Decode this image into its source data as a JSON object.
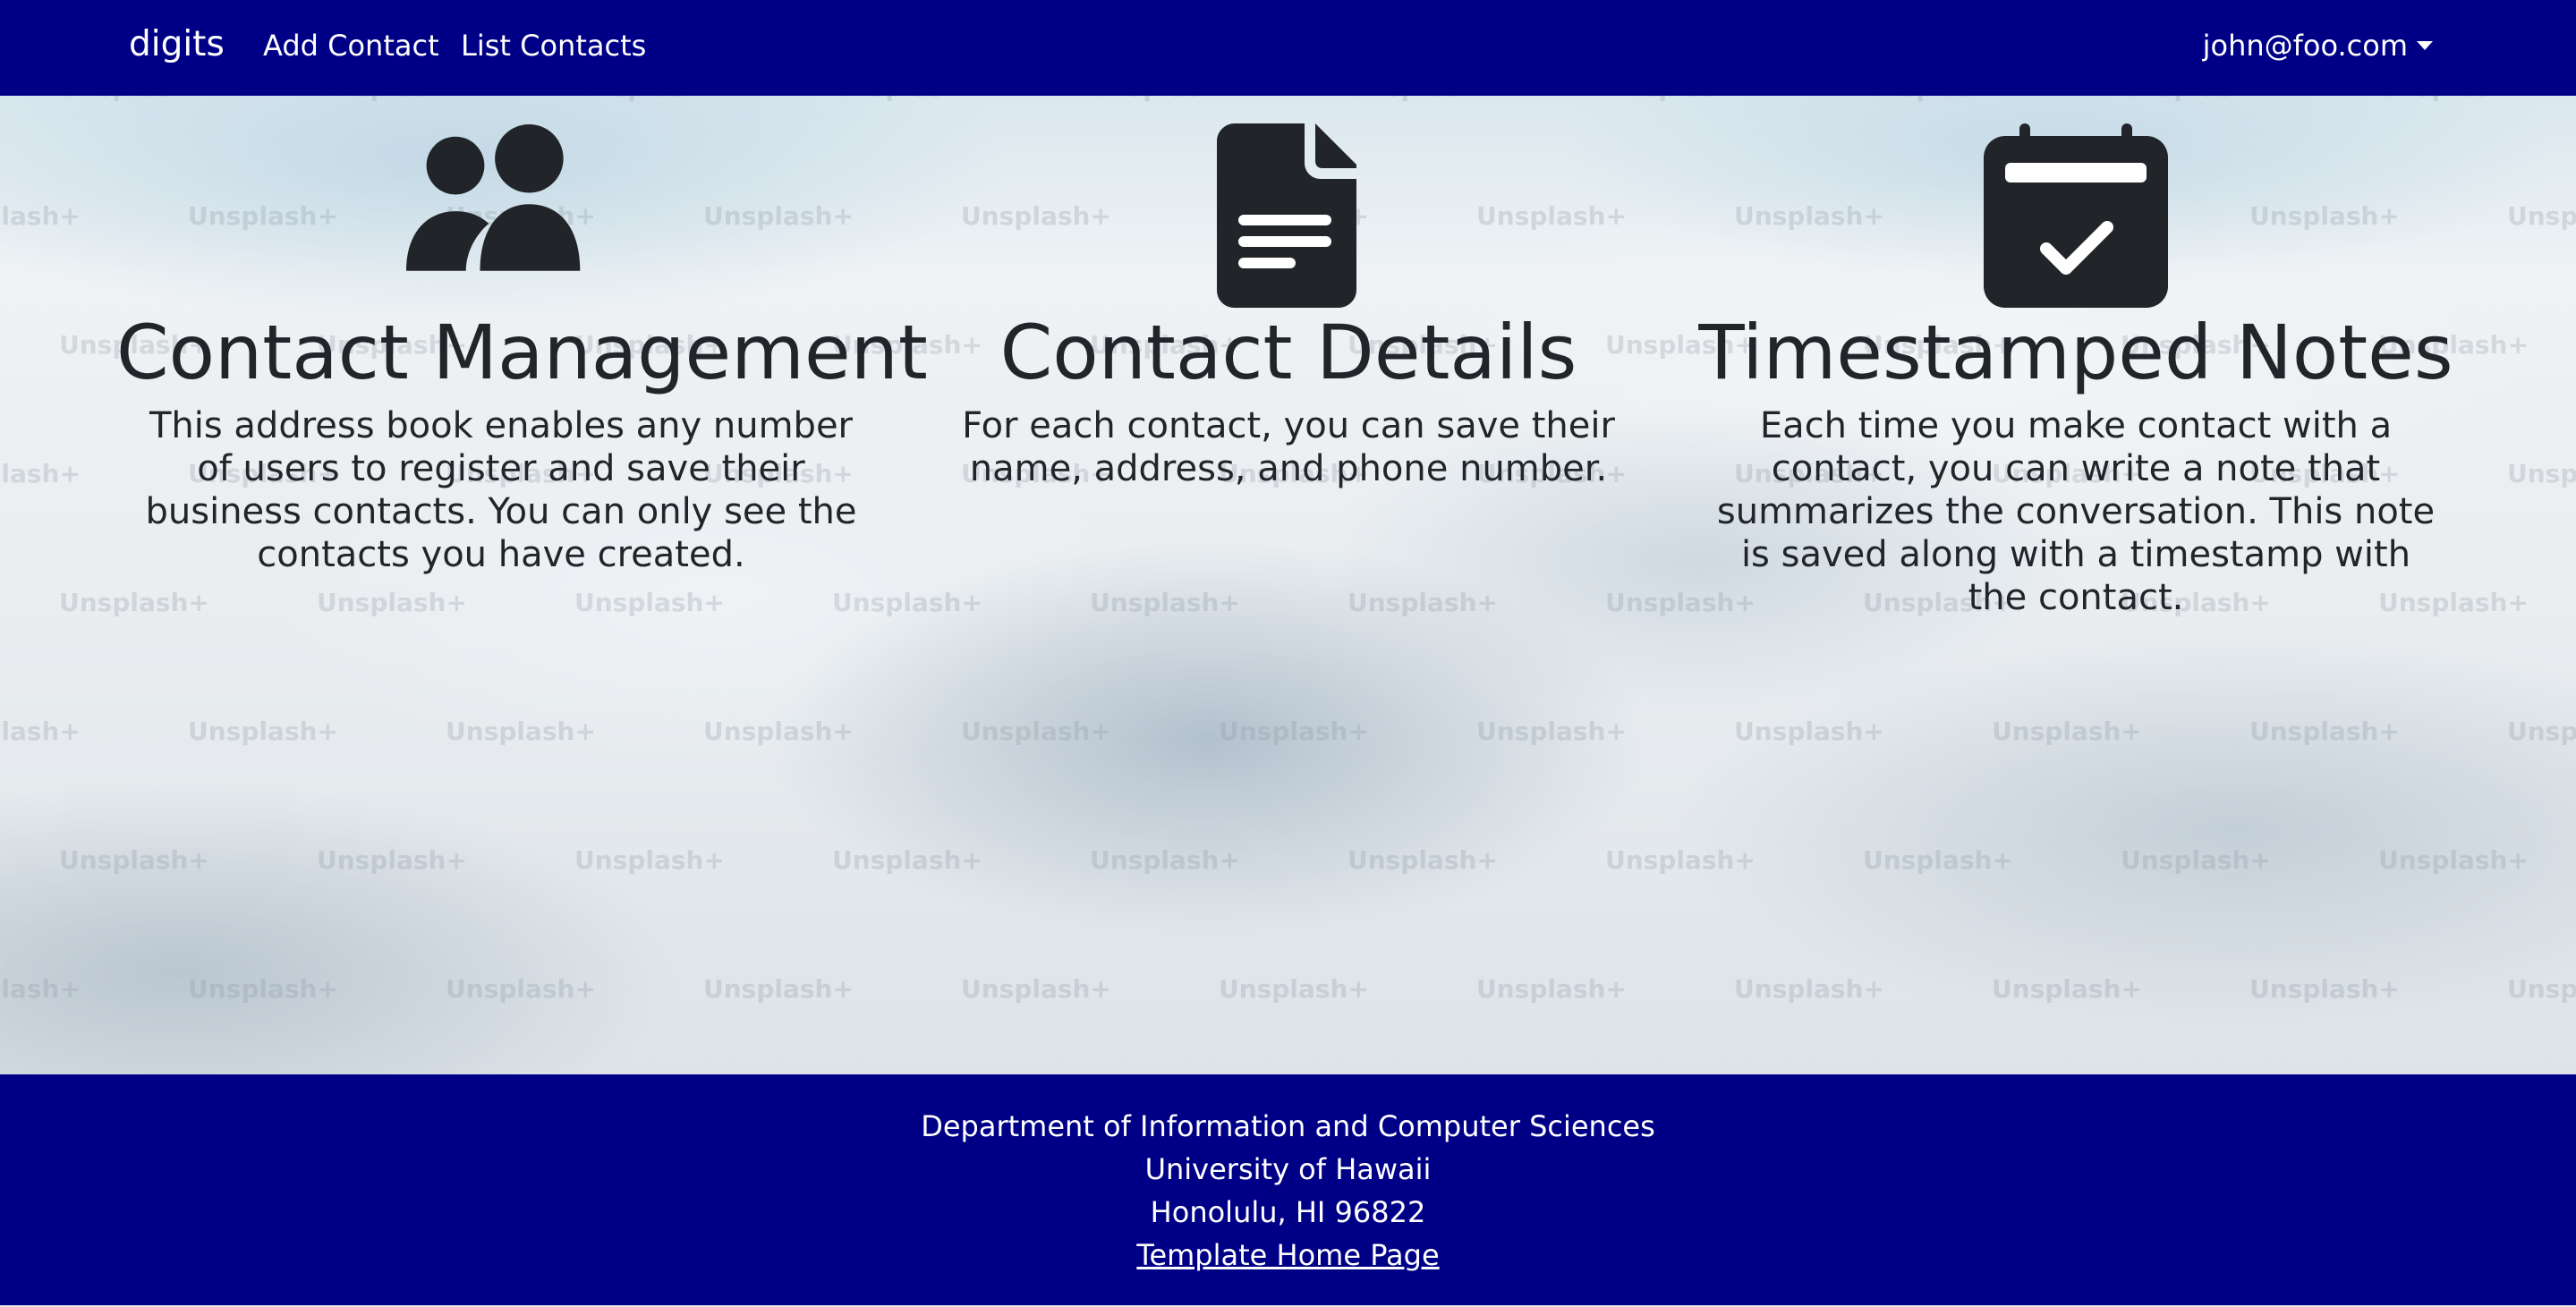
{
  "navbar": {
    "brand": "digits",
    "links": [
      "Add Contact",
      "List Contacts"
    ],
    "user": "john@foo.com",
    "background": "#000087"
  },
  "hero": {
    "watermark_text": "Unsplash+",
    "features": [
      {
        "icon": "users-icon",
        "title": "Contact Management",
        "text": "This address book enables any number of users to register and save their business contacts. You can only see the contacts you have created."
      },
      {
        "icon": "file-lines-icon",
        "title": "Contact Details",
        "text": "For each contact, you can save their name, address, and phone number."
      },
      {
        "icon": "calendar-check-icon",
        "title": "Timestamped Notes",
        "text": "Each time you make contact with a contact, you can write a note that summarizes the conversation. This note is saved along with a timestamp with the contact."
      }
    ]
  },
  "footer": {
    "lines": [
      "Department of Information and Computer Sciences",
      "University of Hawaii",
      "Honolulu, HI 96822"
    ],
    "link": "Template Home Page",
    "background": "#000087"
  }
}
